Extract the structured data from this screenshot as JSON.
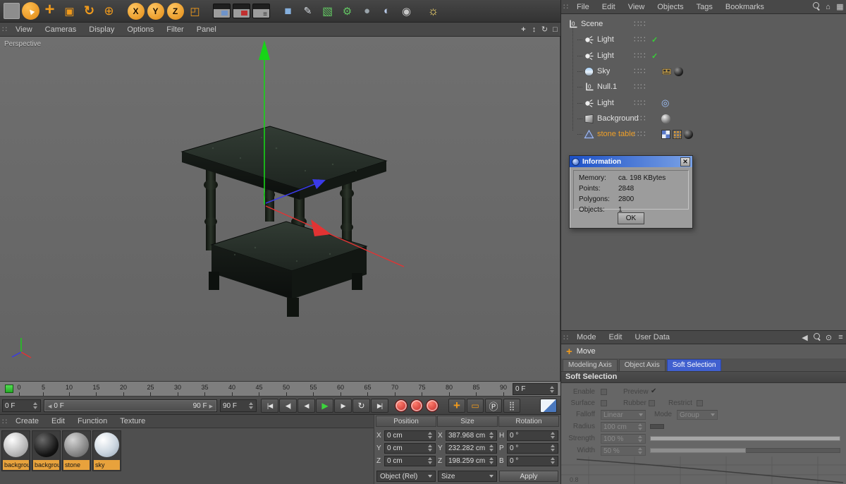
{
  "colors": {
    "accent_orange": "#f09a1c",
    "selected_object_orange": "#f0a028",
    "active_tab_blue": "#4060cf",
    "axis_green": "#17d417",
    "axis_red": "#e23333",
    "axis_blue": "#3a3ae8",
    "record_red": "#bb1f1f",
    "material_label_orange": "#e8a23c",
    "dialog_title_blue": "#1b4fc6"
  },
  "toolbar": {
    "axis_labels": {
      "x": "X",
      "y": "Y",
      "z": "Z"
    },
    "icon_names": [
      "empty-slot",
      "live-selection-tool",
      "move-tool",
      "scale-tool",
      "rotate-tool",
      "last-used-tool",
      "lock-x-axis",
      "lock-y-axis",
      "lock-z-axis",
      "coordinate-system",
      "render-view",
      "render-active-view",
      "render-settings",
      "add-primitive",
      "add-spline",
      "add-nurbs",
      "add-modeling-object",
      "add-deformer",
      "add-scene-object",
      "add-camera",
      "add-light"
    ]
  },
  "viewport": {
    "menu": [
      "View",
      "Cameras",
      "Display",
      "Options",
      "Filter",
      "Panel"
    ],
    "label": "Perspective",
    "nav_icon_names": [
      "pan-view",
      "zoom-view",
      "rotate-view",
      "toggle-view"
    ]
  },
  "timeline": {
    "ticks": [
      "0",
      "5",
      "10",
      "15",
      "20",
      "25",
      "30",
      "35",
      "40",
      "45",
      "50",
      "55",
      "60",
      "65",
      "70",
      "75",
      "80",
      "85",
      "90"
    ],
    "frame_field": "0 F"
  },
  "transport": {
    "current_frame": "0 F",
    "range_start": "0 F",
    "range_end": "90 F",
    "end_frame": "90 F",
    "button_names": [
      "goto-start",
      "prev-key",
      "play-backward",
      "play-forward",
      "next-frame",
      "loop",
      "goto-end",
      "record-keyframe",
      "record-position",
      "record-parameter",
      "keyframe-position",
      "keyframe-scale",
      "keyframe-parameter",
      "keyframe-pla",
      "display-mode"
    ]
  },
  "materials": {
    "menu": [
      "Create",
      "Edit",
      "Function",
      "Texture"
    ],
    "items": [
      {
        "label": "background"
      },
      {
        "label": "background"
      },
      {
        "label": "stone"
      },
      {
        "label": "sky"
      }
    ]
  },
  "coordinates": {
    "headers": [
      "Position",
      "Size",
      "Rotation"
    ],
    "position": {
      "rows": [
        {
          "label": "X",
          "value": "0 cm"
        },
        {
          "label": "Y",
          "value": "0 cm"
        },
        {
          "label": "Z",
          "value": "0 cm"
        }
      ],
      "dropdown": "Object (Rel)"
    },
    "size": {
      "rows": [
        {
          "label": "X",
          "value": "387.968 cm"
        },
        {
          "label": "Y",
          "value": "232.282 cm"
        },
        {
          "label": "Z",
          "value": "198.259 cm"
        }
      ],
      "dropdown": "Size"
    },
    "rotation": {
      "rows": [
        {
          "label": "H",
          "value": "0 °"
        },
        {
          "label": "P",
          "value": "0 °"
        },
        {
          "label": "B",
          "value": "0 °"
        }
      ],
      "apply_label": "Apply"
    }
  },
  "object_manager": {
    "menu": [
      "File",
      "Edit",
      "View",
      "Objects",
      "Tags",
      "Bookmarks"
    ],
    "items": [
      {
        "label": "Scene",
        "icon": "null-object",
        "selected": false
      },
      {
        "label": "Light",
        "icon": "light-object",
        "selected": false
      },
      {
        "label": "Light",
        "icon": "light-object",
        "selected": false
      },
      {
        "label": "Sky",
        "icon": "sky-object",
        "selected": false
      },
      {
        "label": "Null.1",
        "icon": "null-object",
        "selected": false
      },
      {
        "label": "Light",
        "icon": "light-object",
        "selected": false
      },
      {
        "label": "Background",
        "icon": "background-object",
        "selected": false
      },
      {
        "label": "stone table",
        "icon": "polygon-object",
        "selected": true
      }
    ]
  },
  "info_dialog": {
    "title": "Information",
    "rows": [
      {
        "label": "Memory:",
        "value": "ca. 198 KBytes"
      },
      {
        "label": "Points:",
        "value": "2848"
      },
      {
        "label": "Polygons:",
        "value": "2800"
      },
      {
        "label": "Objects:",
        "value": "1"
      }
    ],
    "ok_label": "OK"
  },
  "attribute_manager": {
    "menu": [
      "Mode",
      "Edit",
      "User Data"
    ],
    "tool_label": "Move",
    "tabs": [
      "Modeling Axis",
      "Object Axis",
      "Soft Selection"
    ],
    "active_tab": "Soft Selection",
    "section_title": "Soft Selection",
    "fields": {
      "enable": "Enable",
      "preview": "Preview",
      "surface": "Surface",
      "rubber": "Rubber",
      "restrict": "Restrict",
      "falloff": "Falloff",
      "falloff_value": "Linear",
      "mode": "Mode",
      "mode_value": "Group",
      "radius": "Radius",
      "radius_value": "100 cm",
      "strength": "Strength",
      "strength_value": "100 %",
      "width": "Width",
      "width_value": "50 %"
    },
    "graph_label": "0.8"
  }
}
